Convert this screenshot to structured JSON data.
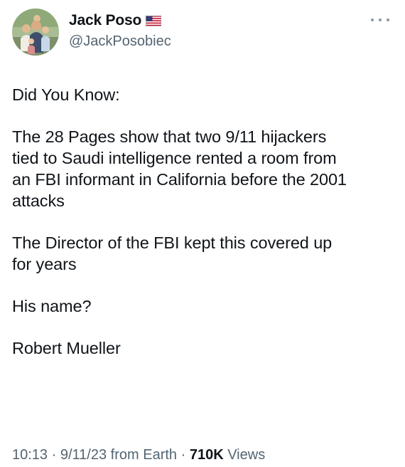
{
  "author": {
    "display_name": "Jack Poso",
    "flag_icon": "us-flag-icon",
    "handle": "@JackPosobiec"
  },
  "more_icon": "more-options-icon",
  "tweet": {
    "paragraphs": [
      "Did You Know:",
      "The 28 Pages show that two 9/11 hijackers\ntied to Saudi intelligence rented a room from\nan FBI informant in California before the 2001\nattacks",
      "The Director of the FBI kept this covered up\nfor years",
      "His name?",
      "Robert Mueller"
    ]
  },
  "meta": {
    "time": "10:13",
    "separator": "·",
    "date": "9/11/23",
    "source": "from Earth",
    "views_count": "710K",
    "views_label": "Views"
  },
  "colors": {
    "text": "#0f1419",
    "secondary": "#536471"
  }
}
